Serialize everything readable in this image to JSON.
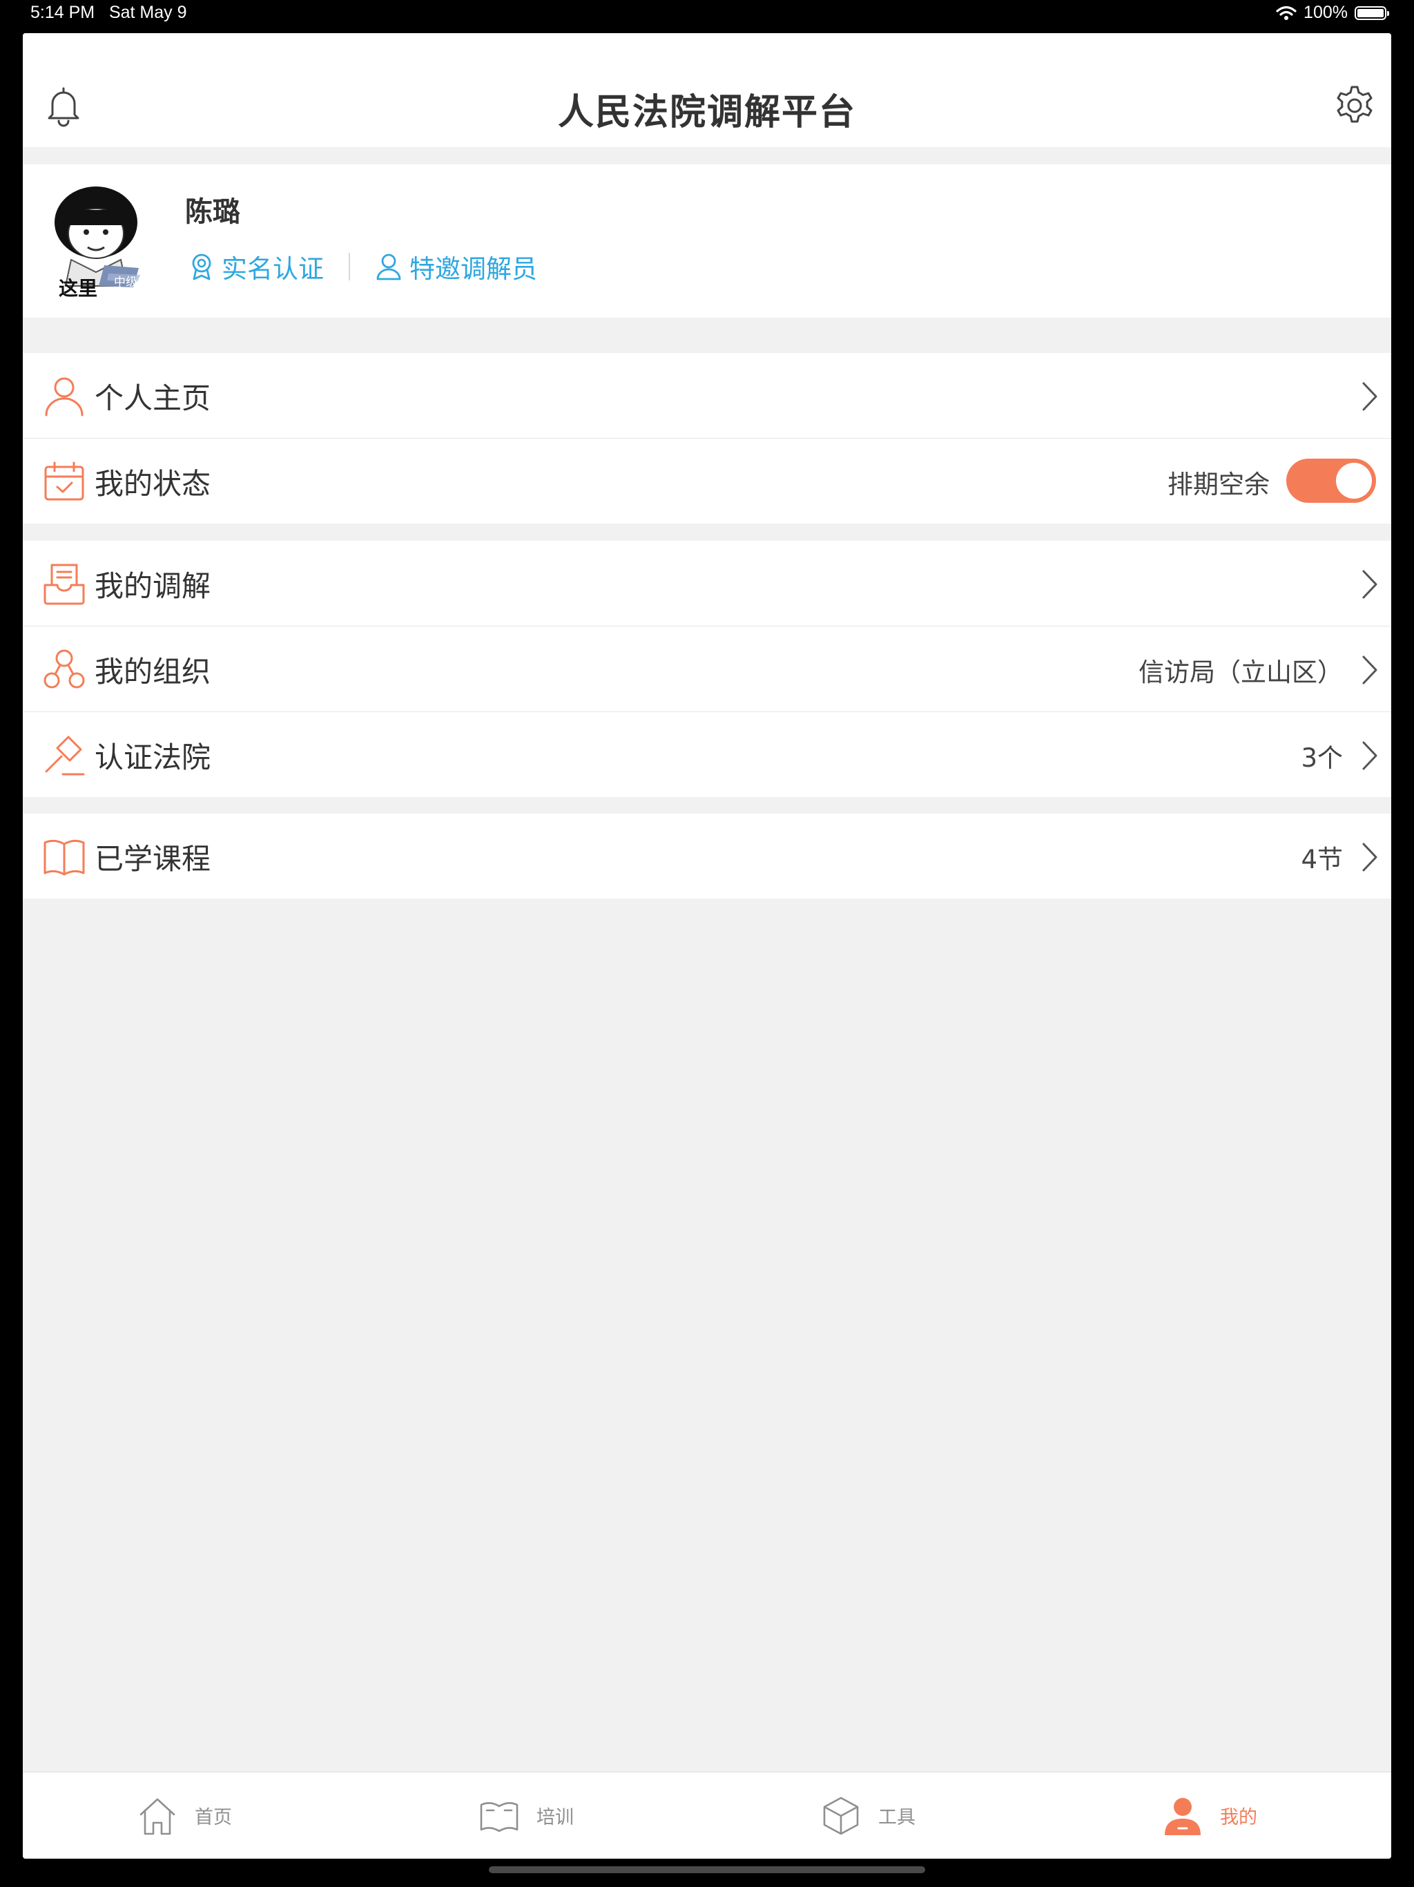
{
  "status_bar": {
    "time": "5:14 PM",
    "date": "Sat May 9",
    "battery": "100%",
    "battery_level": 1.0
  },
  "header": {
    "title": "人民法院调解平台",
    "left_icon": "bell-icon",
    "right_icon": "gear-icon"
  },
  "profile": {
    "name": "陈璐",
    "avatar_caption": "这里",
    "avatar_badge": "中级",
    "badges": [
      {
        "label": "实名认证",
        "icon": "award-icon"
      },
      {
        "label": "特邀调解员",
        "icon": "person-icon"
      }
    ]
  },
  "menu": {
    "personal_home": {
      "label": "个人主页",
      "icon": "person-icon"
    },
    "my_status": {
      "label": "我的状态",
      "value": "排期空余",
      "toggle_on": true,
      "icon": "calendar-check-icon"
    },
    "my_mediation": {
      "label": "我的调解",
      "icon": "document-tray-icon"
    },
    "my_org": {
      "label": "我的组织",
      "value": "信访局（立山区）",
      "icon": "org-circles-icon"
    },
    "certified_courts": {
      "label": "认证法院",
      "value": "3个",
      "icon": "gavel-icon"
    },
    "courses": {
      "label": "已学课程",
      "value": "4节",
      "icon": "book-icon"
    }
  },
  "tabbar": {
    "tabs": [
      {
        "label": "首页",
        "icon": "home-icon",
        "active": false
      },
      {
        "label": "培训",
        "icon": "book-icon",
        "active": false
      },
      {
        "label": "工具",
        "icon": "cube-icon",
        "active": false
      },
      {
        "label": "我的",
        "icon": "user-icon",
        "active": true
      }
    ]
  },
  "colors": {
    "accent": "#f47d57",
    "link": "#2ea7e0",
    "background": "#f1f1f1"
  }
}
